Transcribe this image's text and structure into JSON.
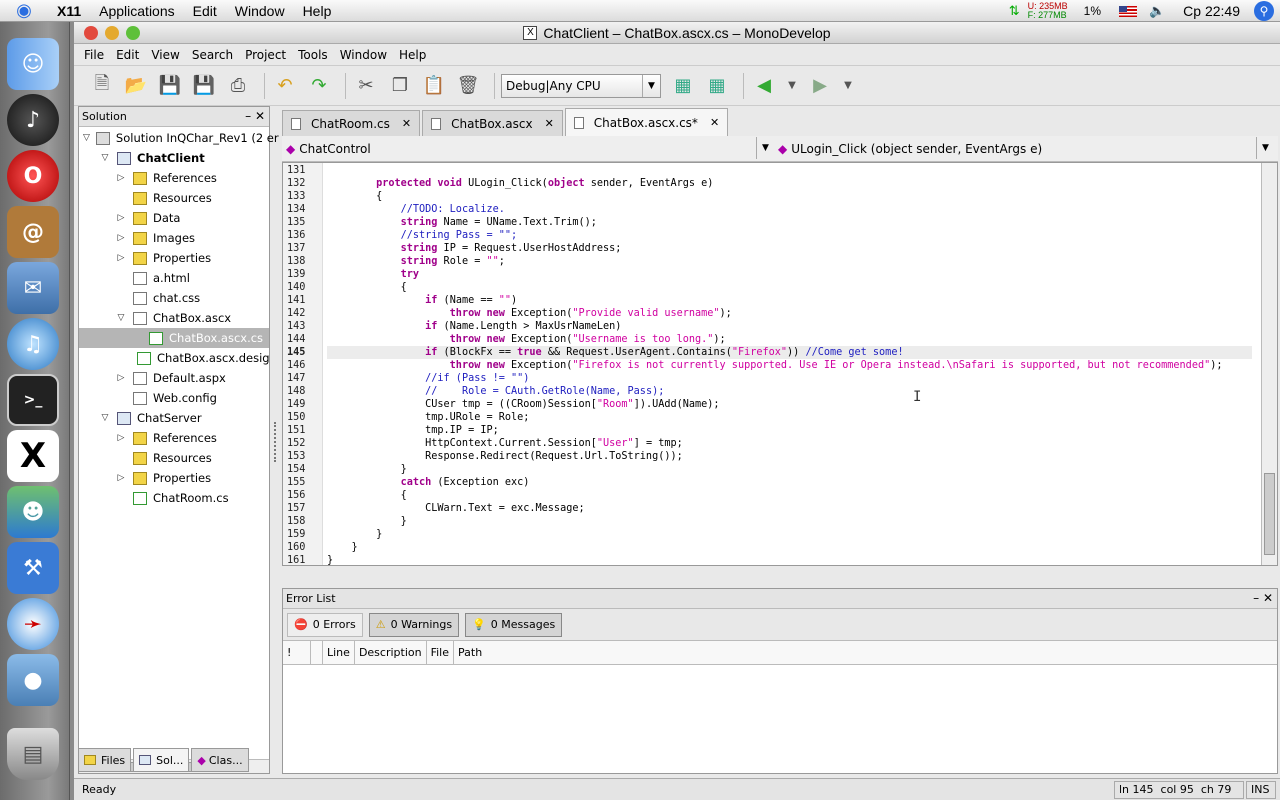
{
  "system_menu": {
    "app": "X11",
    "items": [
      "Applications",
      "Edit",
      "Window",
      "Help"
    ],
    "mem_u": "U: 235MB",
    "mem_f": "F: 277MB",
    "cpu": "1%",
    "clock": "Cp 22:49"
  },
  "window": {
    "title": "ChatClient – ChatBox.ascx.cs – MonoDevelop",
    "menu": [
      "File",
      "Edit",
      "View",
      "Search",
      "Project",
      "Tools",
      "Window",
      "Help"
    ]
  },
  "toolbar": {
    "config": "Debug|Any CPU"
  },
  "solution_pad": {
    "title": "Solution",
    "items": [
      {
        "label": "Solution InQChar_Rev1 (2 er",
        "depth": 0,
        "exp": "▽",
        "icon": "sln"
      },
      {
        "label": "ChatClient",
        "depth": 1,
        "exp": "▽",
        "icon": "proj",
        "bold": true
      },
      {
        "label": "References",
        "depth": 2,
        "exp": "▷",
        "icon": "folder"
      },
      {
        "label": "Resources",
        "depth": 2,
        "exp": "",
        "icon": "folder"
      },
      {
        "label": "Data",
        "depth": 2,
        "exp": "▷",
        "icon": "folder"
      },
      {
        "label": "Images",
        "depth": 2,
        "exp": "▷",
        "icon": "folder"
      },
      {
        "label": "Properties",
        "depth": 2,
        "exp": "▷",
        "icon": "folder"
      },
      {
        "label": "a.html",
        "depth": 2,
        "exp": "",
        "icon": "file"
      },
      {
        "label": "chat.css",
        "depth": 2,
        "exp": "",
        "icon": "file"
      },
      {
        "label": "ChatBox.ascx",
        "depth": 2,
        "exp": "▽",
        "icon": "file"
      },
      {
        "label": "ChatBox.ascx.cs",
        "depth": 3,
        "exp": "",
        "icon": "cs",
        "selected": true
      },
      {
        "label": "ChatBox.ascx.desig",
        "depth": 3,
        "exp": "",
        "icon": "cs"
      },
      {
        "label": "Default.aspx",
        "depth": 2,
        "exp": "▷",
        "icon": "file"
      },
      {
        "label": "Web.config",
        "depth": 2,
        "exp": "",
        "icon": "file"
      },
      {
        "label": "ChatServer",
        "depth": 1,
        "exp": "▽",
        "icon": "proj"
      },
      {
        "label": "References",
        "depth": 2,
        "exp": "▷",
        "icon": "folder"
      },
      {
        "label": "Resources",
        "depth": 2,
        "exp": "",
        "icon": "folder"
      },
      {
        "label": "Properties",
        "depth": 2,
        "exp": "▷",
        "icon": "folder"
      },
      {
        "label": "ChatRoom.cs",
        "depth": 2,
        "exp": "",
        "icon": "cs"
      }
    ],
    "tabs": [
      "Files",
      "Sol...",
      "Clas..."
    ]
  },
  "editor": {
    "tabs": [
      {
        "label": "ChatRoom.cs",
        "active": false
      },
      {
        "label": "ChatBox.ascx",
        "active": false
      },
      {
        "label": "ChatBox.ascx.cs*",
        "active": true
      }
    ],
    "class_combo": "ChatControl",
    "member_combo": "ULogin_Click (object sender, EventArgs e)",
    "current_line": 145,
    "lines": [
      {
        "n": 131,
        "t": []
      },
      {
        "n": 132,
        "t": [
          [
            "        ",
            ""
          ],
          [
            "protected void",
            "kw"
          ],
          [
            " ULogin_Click(",
            ""
          ],
          [
            "object",
            "kw"
          ],
          [
            " sender, EventArgs e)",
            ""
          ]
        ]
      },
      {
        "n": 133,
        "t": [
          [
            "        {",
            ""
          ]
        ]
      },
      {
        "n": 134,
        "t": [
          [
            "            ",
            ""
          ],
          [
            "//TODO: Localize.",
            "cm"
          ]
        ]
      },
      {
        "n": 135,
        "t": [
          [
            "            ",
            ""
          ],
          [
            "string",
            "kw"
          ],
          [
            " Name = UName.Text.Trim();",
            ""
          ]
        ]
      },
      {
        "n": 136,
        "t": [
          [
            "            ",
            ""
          ],
          [
            "//string Pass = \"\";",
            "cm"
          ]
        ]
      },
      {
        "n": 137,
        "t": [
          [
            "            ",
            ""
          ],
          [
            "string",
            "kw"
          ],
          [
            " IP = Request.UserHostAddress;",
            ""
          ]
        ]
      },
      {
        "n": 138,
        "t": [
          [
            "            ",
            ""
          ],
          [
            "string",
            "kw"
          ],
          [
            " Role = ",
            ""
          ],
          [
            "\"\"",
            "st"
          ],
          [
            ";",
            ""
          ]
        ]
      },
      {
        "n": 139,
        "t": [
          [
            "            ",
            ""
          ],
          [
            "try",
            "kw"
          ]
        ]
      },
      {
        "n": 140,
        "t": [
          [
            "            {",
            ""
          ]
        ]
      },
      {
        "n": 141,
        "t": [
          [
            "                ",
            ""
          ],
          [
            "if",
            "kw"
          ],
          [
            " (Name == ",
            ""
          ],
          [
            "\"\"",
            "st"
          ],
          [
            ")",
            ""
          ]
        ]
      },
      {
        "n": 142,
        "t": [
          [
            "                    ",
            ""
          ],
          [
            "throw new",
            "kw"
          ],
          [
            " Exception(",
            ""
          ],
          [
            "\"Provide valid username\"",
            "st"
          ],
          [
            ");",
            ""
          ]
        ]
      },
      {
        "n": 143,
        "t": [
          [
            "                ",
            ""
          ],
          [
            "if",
            "kw"
          ],
          [
            " (Name.Length > MaxUsrNameLen)",
            ""
          ]
        ]
      },
      {
        "n": 144,
        "t": [
          [
            "                    ",
            ""
          ],
          [
            "throw new",
            "kw"
          ],
          [
            " Exception(",
            ""
          ],
          [
            "\"Username is too long.\"",
            "st"
          ],
          [
            ");",
            ""
          ]
        ]
      },
      {
        "n": 145,
        "t": [
          [
            "                ",
            ""
          ],
          [
            "if",
            "kw"
          ],
          [
            " (BlockFx == ",
            ""
          ],
          [
            "true",
            "kw"
          ],
          [
            " && Request.UserAgent.Contains(",
            ""
          ],
          [
            "\"Firefox\"",
            "st"
          ],
          [
            ")) ",
            ""
          ],
          [
            "//Come get some!",
            "cm"
          ]
        ]
      },
      {
        "n": 146,
        "t": [
          [
            "                    ",
            ""
          ],
          [
            "throw new",
            "kw"
          ],
          [
            " Exception(",
            ""
          ],
          [
            "\"Firefox is not currently supported. Use IE or Opera instead.\\nSafari is supported, but not recommended\"",
            "st"
          ],
          [
            ");",
            ""
          ]
        ]
      },
      {
        "n": 147,
        "t": [
          [
            "                ",
            ""
          ],
          [
            "//if (Pass != \"\")",
            "cm"
          ]
        ]
      },
      {
        "n": 148,
        "t": [
          [
            "                ",
            ""
          ],
          [
            "//    Role = CAuth.GetRole(Name, Pass);",
            "cm"
          ]
        ]
      },
      {
        "n": 149,
        "t": [
          [
            "                CUser tmp = ((CRoom)Session[",
            ""
          ],
          [
            "\"Room\"",
            "st"
          ],
          [
            "]).UAdd(Name);",
            ""
          ]
        ]
      },
      {
        "n": 150,
        "t": [
          [
            "                tmp.URole = Role;",
            ""
          ]
        ]
      },
      {
        "n": 151,
        "t": [
          [
            "                tmp.IP = IP;",
            ""
          ]
        ]
      },
      {
        "n": 152,
        "t": [
          [
            "                HttpContext.Current.Session[",
            ""
          ],
          [
            "\"User\"",
            "st"
          ],
          [
            "] = tmp;",
            ""
          ]
        ]
      },
      {
        "n": 153,
        "t": [
          [
            "                Response.Redirect(Request.Url.ToString());",
            ""
          ]
        ]
      },
      {
        "n": 154,
        "t": [
          [
            "            }",
            ""
          ]
        ]
      },
      {
        "n": 155,
        "t": [
          [
            "            ",
            ""
          ],
          [
            "catch",
            "kw"
          ],
          [
            " (Exception exc)",
            ""
          ]
        ]
      },
      {
        "n": 156,
        "t": [
          [
            "            {",
            ""
          ]
        ]
      },
      {
        "n": 157,
        "t": [
          [
            "                CLWarn.Text = exc.Message;",
            ""
          ]
        ]
      },
      {
        "n": 158,
        "t": [
          [
            "            }",
            ""
          ]
        ]
      },
      {
        "n": 159,
        "t": [
          [
            "        }",
            ""
          ]
        ]
      },
      {
        "n": 160,
        "t": [
          [
            "    }",
            ""
          ]
        ]
      },
      {
        "n": 161,
        "t": [
          [
            "}",
            ""
          ]
        ]
      }
    ]
  },
  "error_list": {
    "title": "Error List",
    "errors": "0 Errors",
    "warnings": "0 Warnings",
    "messages": "0 Messages",
    "columns": [
      "!",
      "",
      "Line",
      "Description",
      "File",
      "Path"
    ]
  },
  "status": {
    "text": "Ready",
    "ln": "ln 145",
    "col": "col 95",
    "ch": "ch 79",
    "mode": "INS"
  }
}
